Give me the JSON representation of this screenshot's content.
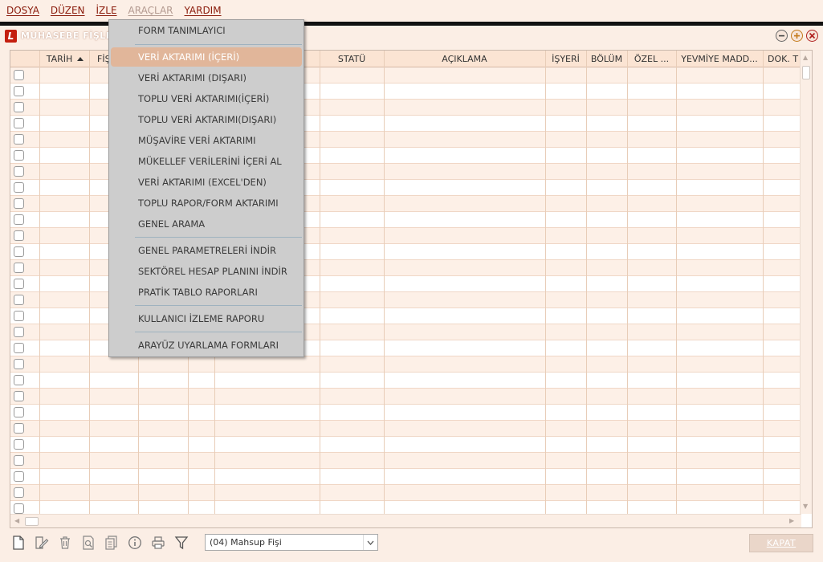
{
  "menubar": {
    "items": [
      {
        "id": "dosya",
        "label": "DOSYA"
      },
      {
        "id": "duzen",
        "label": "DÜZEN"
      },
      {
        "id": "izle",
        "label": "İZLE"
      },
      {
        "id": "araclar",
        "label": "ARAÇLAR"
      },
      {
        "id": "yardim",
        "label": "YARDIM"
      }
    ]
  },
  "window": {
    "title": "MUHASEBE FİŞLE",
    "logo_letter": "L",
    "controls": [
      "minimize-icon",
      "maximize-icon",
      "close-icon"
    ]
  },
  "grid": {
    "columns": [
      {
        "id": "tarih",
        "label": "TARİH"
      },
      {
        "id": "fis",
        "label": "FİŞ"
      },
      {
        "id": "statu",
        "label": "STATÜ"
      },
      {
        "id": "aciklama",
        "label": "AÇIKLAMA"
      },
      {
        "id": "isyeri",
        "label": "İŞYERİ"
      },
      {
        "id": "bolum",
        "label": "BÖLÜM"
      },
      {
        "id": "ozel",
        "label": "ÖZEL ..."
      },
      {
        "id": "yevmiye",
        "label": "YEVMİYE MADD..."
      },
      {
        "id": "dok",
        "label": "DOK. T"
      }
    ],
    "sort_column": "tarih",
    "sort_direction": "ascending"
  },
  "dropdown": {
    "parent_menu": "ARAÇLAR",
    "items": [
      {
        "label": "FORM TANIMLAYICI"
      },
      {
        "label": "VERİ AKTARIMI (İÇERİ)",
        "highlighted": true
      },
      {
        "label": "VERİ AKTARIMI (DIŞARI)"
      },
      {
        "label": "TOPLU VERİ AKTARIMI(İÇERİ)"
      },
      {
        "label": "TOPLU VERİ AKTARIMI(DIŞARI)"
      },
      {
        "label": "MÜŞAVİRE VERİ AKTARIMI"
      },
      {
        "label": "MÜKELLEF VERİLERİNİ İÇERİ AL"
      },
      {
        "label": "VERİ AKTARIMI (EXCEL'DEN)"
      },
      {
        "label": "TOPLU RAPOR/FORM AKTARIMI"
      },
      {
        "label": "GENEL ARAMA"
      },
      {
        "label": "GENEL PARAMETRELERİ İNDİR"
      },
      {
        "label": "SEKTÖREL HESAP PLANINI İNDİR"
      },
      {
        "label": "PRATİK TABLO RAPORLARI"
      },
      {
        "label": "KULLANICI İZLEME RAPORU"
      },
      {
        "label": "ARAYÜZ UYARLAMA FORMLARI"
      }
    ]
  },
  "toolbar": {
    "icons": [
      "new-document-icon",
      "edit-icon",
      "delete-icon",
      "preview-icon",
      "copy-icon",
      "info-icon",
      "print-icon",
      "filter-icon"
    ],
    "document_type": "(04) Mahsup Fişi",
    "close_label": "KAPAT"
  },
  "colors": {
    "background": "#fbeee5",
    "menu_text": "#8a1a0a",
    "header_bg": "#fbe4d3",
    "dropdown_bg": "#cdcdcd",
    "highlight": "#e1b69a",
    "logo": "#c41e0e"
  }
}
